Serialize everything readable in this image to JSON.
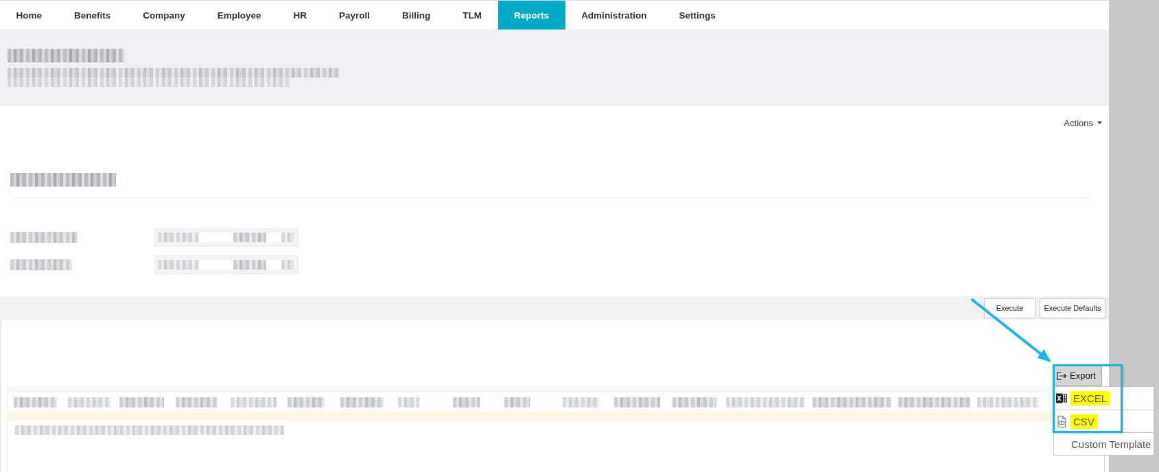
{
  "nav": {
    "tabs": [
      {
        "label": "Home",
        "selected": false
      },
      {
        "label": "Benefits",
        "selected": false
      },
      {
        "label": "Company",
        "selected": false
      },
      {
        "label": "Employee",
        "selected": false
      },
      {
        "label": "HR",
        "selected": false
      },
      {
        "label": "Payroll",
        "selected": false
      },
      {
        "label": "Billing",
        "selected": false
      },
      {
        "label": "TLM",
        "selected": false
      },
      {
        "label": "Reports",
        "selected": true
      },
      {
        "label": "Administration",
        "selected": false
      },
      {
        "label": "Settings",
        "selected": false
      }
    ]
  },
  "actions": {
    "label": "Actions"
  },
  "toolbar": {
    "buttons": [
      "Execute",
      "Execute Defaults"
    ]
  },
  "export": {
    "label": "Export",
    "items": [
      {
        "kind": "excel",
        "label": "EXCEL",
        "highlighted": true
      },
      {
        "kind": "csv",
        "label": "CSV",
        "highlighted": true
      },
      {
        "kind": "plain",
        "label": "Custom Template",
        "highlighted": false
      }
    ]
  },
  "annotations": [
    {
      "kind": "arrow"
    },
    {
      "kind": "frame"
    }
  ]
}
